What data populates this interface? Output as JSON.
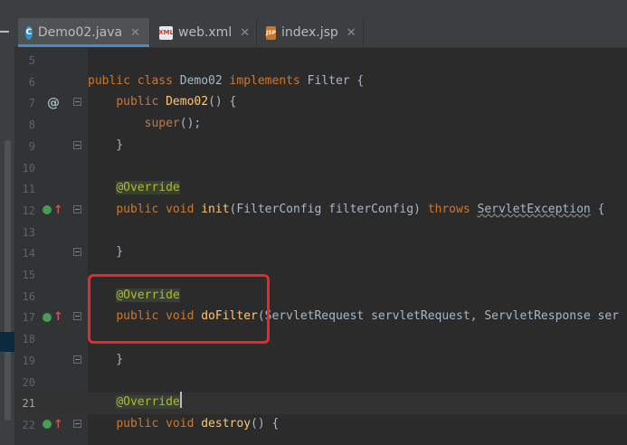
{
  "tabs": [
    {
      "label": "Demo02.java",
      "icon": "class-icon",
      "active": true
    },
    {
      "label": "web.xml",
      "icon": "xml-file-icon",
      "active": false
    },
    {
      "label": "index.jsp",
      "icon": "jsp-file-icon",
      "active": false
    }
  ],
  "close_glyph": "✕",
  "tab_icon_letters": {
    "class": "C",
    "xml": "XML",
    "jsp": "JSP"
  },
  "lines": [
    {
      "n": "5",
      "html": ""
    },
    {
      "n": "6",
      "parts": [
        [
          "kw",
          "public class "
        ],
        [
          "",
          "Demo02 "
        ],
        [
          "kw",
          "implements "
        ],
        [
          "",
          "Filter {"
        ]
      ]
    },
    {
      "n": "7",
      "parts": [
        [
          "",
          "    "
        ],
        [
          "kw",
          "public "
        ],
        [
          "fn",
          "Demo02"
        ],
        [
          "",
          "() {"
        ]
      ]
    },
    {
      "n": "8",
      "parts": [
        [
          "",
          "        "
        ],
        [
          "kw",
          "super"
        ],
        [
          "",
          "();"
        ]
      ]
    },
    {
      "n": "9",
      "parts": [
        [
          "",
          "    }"
        ]
      ]
    },
    {
      "n": "10",
      "parts": []
    },
    {
      "n": "11",
      "parts": [
        [
          "",
          "    "
        ],
        [
          "ann",
          "@Override"
        ]
      ]
    },
    {
      "n": "12",
      "parts": [
        [
          "",
          "    "
        ],
        [
          "kw",
          "public void "
        ],
        [
          "fn",
          "init"
        ],
        [
          "",
          "(FilterConfig filterConfig) "
        ],
        [
          "kw",
          "throws "
        ],
        [
          "warn",
          "ServletException"
        ],
        [
          "",
          " {"
        ]
      ]
    },
    {
      "n": "13",
      "parts": []
    },
    {
      "n": "14",
      "parts": [
        [
          "",
          "    }"
        ]
      ]
    },
    {
      "n": "15",
      "parts": []
    },
    {
      "n": "16",
      "parts": [
        [
          "",
          "    "
        ],
        [
          "ann",
          "@Override"
        ]
      ]
    },
    {
      "n": "17",
      "parts": [
        [
          "",
          "    "
        ],
        [
          "kw",
          "public void "
        ],
        [
          "fn",
          "doFilter"
        ],
        [
          "",
          "(ServletRequest servletRequest, ServletResponse ser"
        ]
      ]
    },
    {
      "n": "18",
      "parts": []
    },
    {
      "n": "19",
      "parts": [
        [
          "",
          "    }"
        ]
      ]
    },
    {
      "n": "20",
      "parts": []
    },
    {
      "n": "21",
      "parts": [
        [
          "",
          "    "
        ],
        [
          "ann",
          "@Override"
        ]
      ]
    },
    {
      "n": "22",
      "parts": [
        [
          "",
          "    "
        ],
        [
          "kw",
          "public void "
        ],
        [
          "fn",
          "destroy"
        ],
        [
          "",
          "() {"
        ]
      ]
    }
  ],
  "gutter_markers": {
    "at_line": "7",
    "at_glyph": "@",
    "override_lines": [
      "12",
      "17",
      "22"
    ],
    "override_arrow": "↑"
  },
  "current_line": "21",
  "colors": {
    "keyword": "#cc7832",
    "function": "#ffc66d",
    "annotation": "#bbb529",
    "text": "#a9b7c6",
    "highlight_box": "#e8282d"
  }
}
